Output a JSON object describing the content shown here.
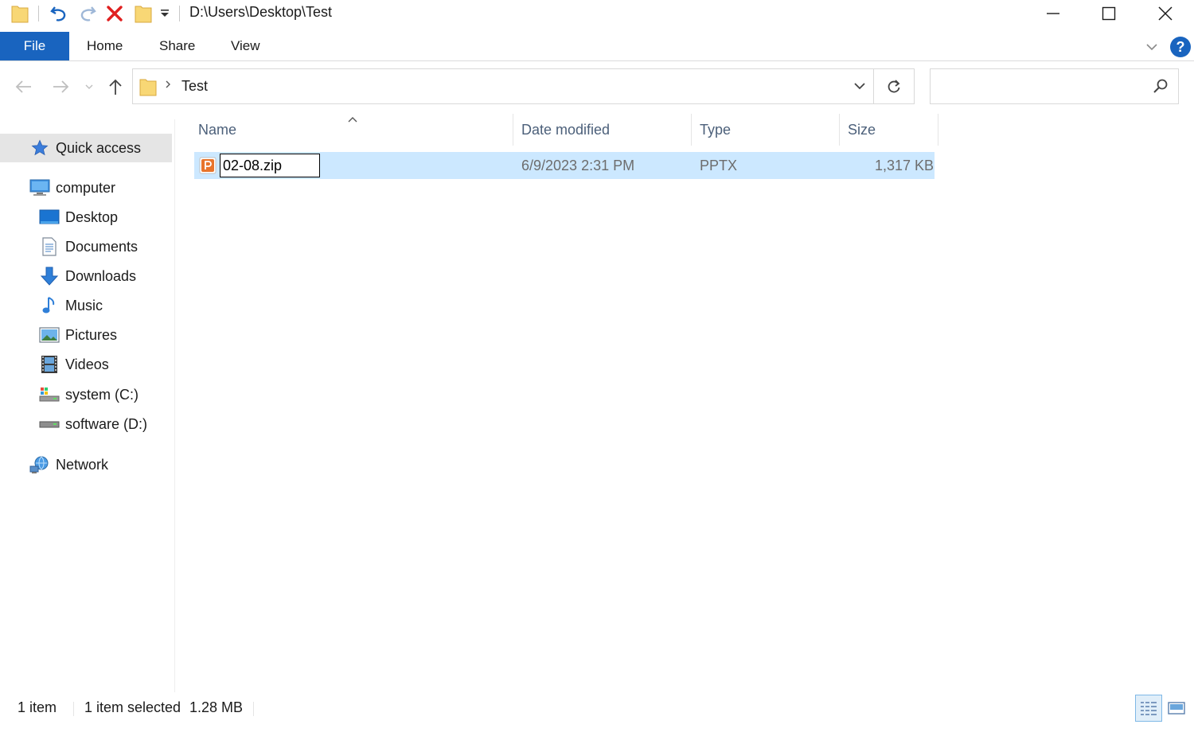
{
  "window": {
    "title_path": "D:\\Users\\Desktop\\Test",
    "controls": [
      "minimize",
      "maximize",
      "close"
    ]
  },
  "quick_access_toolbar": {
    "icons": [
      "folder-icon",
      "undo-icon",
      "redo-icon",
      "delete-icon",
      "new-folder-icon",
      "customize-dropdown-icon"
    ]
  },
  "ribbon": {
    "file_label": "File",
    "tabs": [
      "Home",
      "Share",
      "View"
    ],
    "help_label": "?"
  },
  "address_bar": {
    "current": "Test",
    "search_placeholder": ""
  },
  "sidebar": {
    "quick_access": "Quick access",
    "computer": "computer",
    "items": [
      "Desktop",
      "Documents",
      "Downloads",
      "Music",
      "Pictures",
      "Videos",
      "system (C:)",
      "software (D:)"
    ],
    "network": "Network"
  },
  "columns": {
    "name": "Name",
    "date": "Date modified",
    "type": "Type",
    "size": "Size"
  },
  "files": [
    {
      "name": "02-08.zip",
      "date": "6/9/2023 2:31 PM",
      "type": "PPTX",
      "size": "1,317 KB"
    }
  ],
  "status": {
    "count": "1 item",
    "selected": "1 item selected",
    "size": "1.28 MB"
  },
  "colors": {
    "accent": "#1964bf",
    "selection": "#cce8ff",
    "header_text": "#4c607a"
  }
}
